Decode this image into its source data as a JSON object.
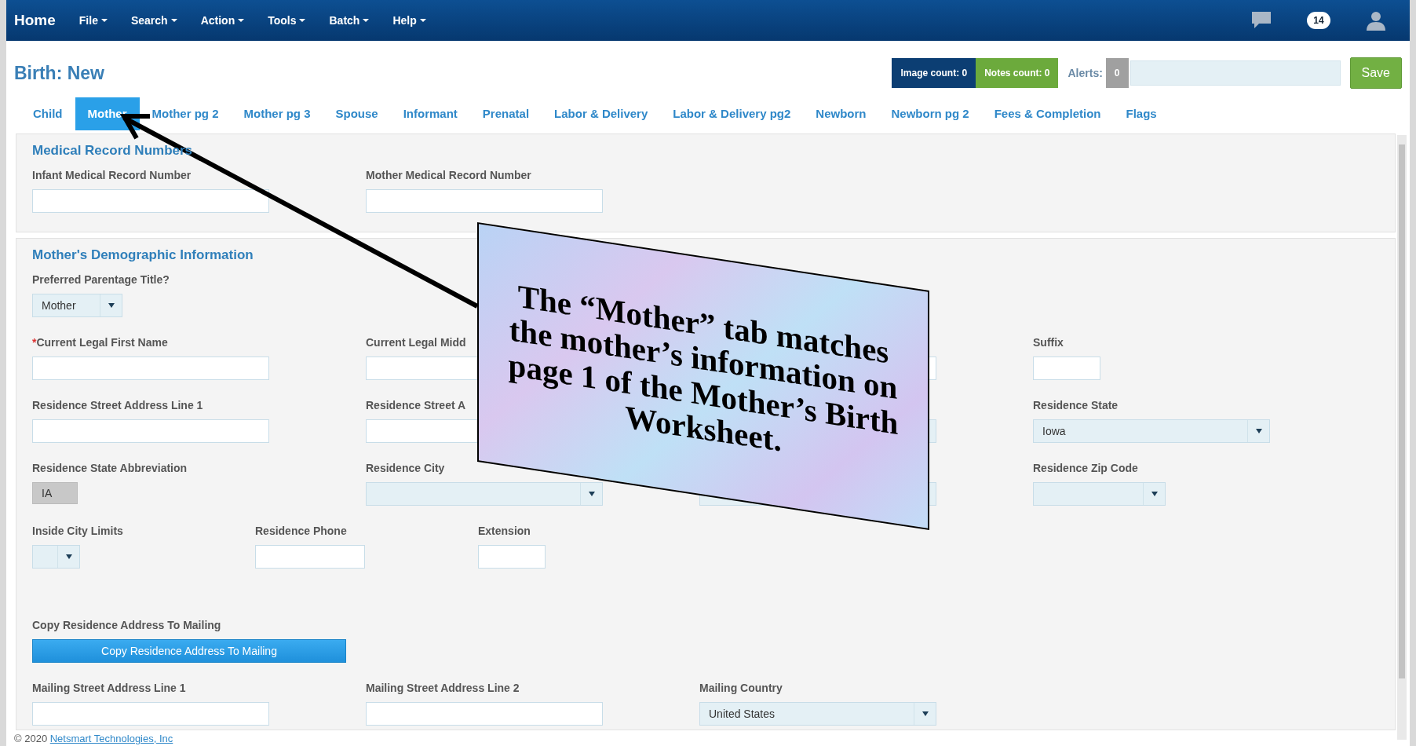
{
  "navbar": {
    "brand": "Home",
    "menus": [
      {
        "label": "File"
      },
      {
        "label": "Search"
      },
      {
        "label": "Action"
      },
      {
        "label": "Tools"
      },
      {
        "label": "Batch"
      },
      {
        "label": "Help"
      }
    ],
    "notification_count": "14"
  },
  "page": {
    "title": "Birth: New",
    "image_count": "Image count: 0",
    "notes_count": "Notes count: 0",
    "alerts_label": "Alerts:",
    "alerts_count": "0",
    "save": "Save"
  },
  "tabs": [
    {
      "label": "Child",
      "selected": false
    },
    {
      "label": "Mother",
      "selected": true
    },
    {
      "label": "Mother pg 2",
      "selected": false
    },
    {
      "label": "Mother pg 3",
      "selected": false
    },
    {
      "label": "Spouse",
      "selected": false
    },
    {
      "label": "Informant",
      "selected": false
    },
    {
      "label": "Prenatal",
      "selected": false
    },
    {
      "label": "Labor & Delivery",
      "selected": false
    },
    {
      "label": "Labor & Delivery pg2",
      "selected": false
    },
    {
      "label": "Newborn",
      "selected": false
    },
    {
      "label": "Newborn pg 2",
      "selected": false
    },
    {
      "label": "Fees & Completion",
      "selected": false
    },
    {
      "label": "Flags",
      "selected": false
    }
  ],
  "sections": [
    {
      "title": "Medical Record Numbers",
      "rows": [
        {
          "kind": "wide",
          "fields": [
            {
              "label": "Infant Medical Record Number",
              "kind": "text"
            },
            {
              "label": "Mother Medical Record Number",
              "kind": "text"
            }
          ]
        }
      ]
    },
    {
      "title": "Mother's Demographic Information",
      "rows": [
        {
          "kind": "wide",
          "fields": [
            {
              "label": "Preferred Parentage Title?",
              "kind": "select",
              "value": "Mother"
            }
          ]
        },
        {
          "kind": "wide",
          "fields": [
            {
              "label": "Current Legal First Name",
              "kind": "text",
              "marker": "*"
            },
            {
              "label": "Current Legal Midd",
              "kind": "text"
            },
            {
              "kind": "text"
            },
            {
              "label": "Suffix",
              "kind": "text"
            }
          ]
        },
        {
          "kind": "wide",
          "fields": [
            {
              "label": "Residence Street Address Line 1",
              "kind": "text"
            },
            {
              "label": "Residence Street A",
              "kind": "text"
            },
            {
              "kind": "select"
            },
            {
              "label": "Residence State",
              "kind": "select",
              "value": "Iowa"
            }
          ]
        },
        {
          "kind": "wide",
          "fields": [
            {
              "label": "Residence State Abbreviation",
              "kind": "readonly",
              "value": "IA"
            },
            {
              "label": "Residence City",
              "kind": "select"
            },
            {
              "kind": "select"
            },
            {
              "label": "Residence Zip Code",
              "kind": "select"
            }
          ]
        },
        {
          "kind": "narrow",
          "fields": [
            {
              "label": "Inside City Limits",
              "kind": "select"
            },
            {
              "label": "Residence Phone",
              "kind": "text"
            },
            {
              "label": "Extension",
              "kind": "text"
            }
          ]
        },
        {
          "kind": "spaced",
          "fields": [
            {
              "label": "Copy Residence Address To Mailing",
              "kind": "button",
              "value": "Copy Residence Address To Mailing"
            }
          ]
        },
        {
          "kind": "wide",
          "fields": [
            {
              "label": "Mailing Street Address Line 1",
              "kind": "text"
            },
            {
              "label": "Mailing Street Address Line 2",
              "kind": "text"
            },
            {
              "label": "Mailing Country",
              "kind": "select",
              "value": "United States"
            }
          ]
        }
      ]
    }
  ],
  "footer": {
    "copyright": "© 2020",
    "company": "Netsmart Technologies, Inc"
  },
  "annotation": {
    "text": "The “Mother” tab matches the mother’s information on page 1 of the Mother’s Birth Worksheet."
  }
}
